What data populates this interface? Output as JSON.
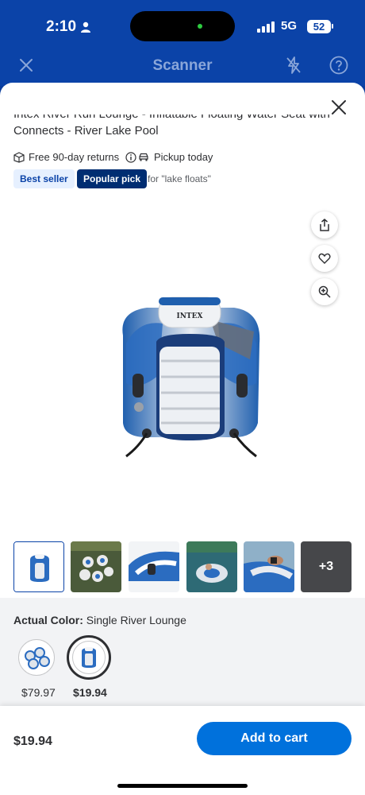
{
  "status_bar": {
    "time": "2:10",
    "network": "5G",
    "battery": "52"
  },
  "scanner": {
    "title": "Scanner"
  },
  "product": {
    "title_line1": "Intex River Run Lounge - Inflatable Floating Water Seat with Quick",
    "title_line2": "Connects - River Lake Pool",
    "shipping": "Free 90-day returns",
    "pickup": "Pickup today",
    "badge_best": "Best seller",
    "badge_popular": "Popular pick",
    "popular_for": "for \"lake floats\"",
    "brand_on_product": "INTEX"
  },
  "gallery": {
    "more_label": "+3"
  },
  "color": {
    "label": "Actual Color:",
    "value": "Single River Lounge",
    "options": [
      {
        "price": "$79.97"
      },
      {
        "price": "$19.94"
      }
    ]
  },
  "cart": {
    "price": "$19.94",
    "button_label": "Add to cart"
  },
  "colors": {
    "brand_blue": "#0b43a8",
    "cta_blue": "#0071dc",
    "navy": "#002d72"
  }
}
